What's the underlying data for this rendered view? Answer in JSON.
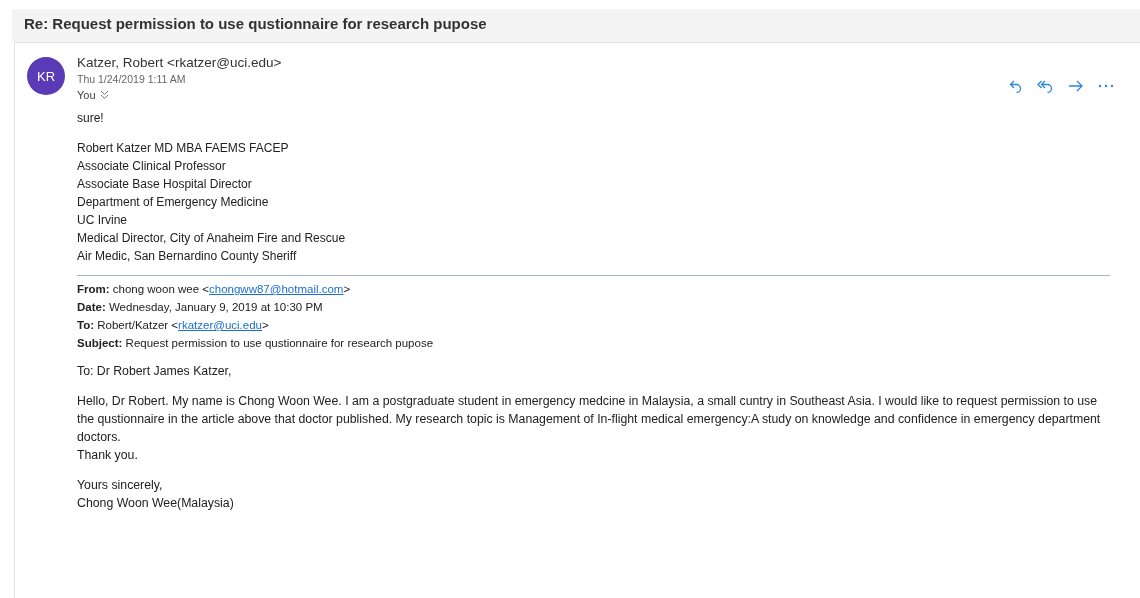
{
  "subject": "Re: Request permission to use qustionnaire for research pupose",
  "message": {
    "avatar_initials": "KR",
    "sender": "Katzer, Robert <rkatzer@uci.edu>",
    "date": "Thu 1/24/2019 1:11 AM",
    "recipient": "You",
    "actions": [
      {
        "kind": "reply"
      },
      {
        "kind": "reply_all"
      },
      {
        "kind": "forward"
      },
      {
        "kind": "more"
      }
    ],
    "body": "sure!",
    "signature": [
      "Robert Katzer MD MBA FAEMS FACEP",
      "Associate Clinical Professor",
      "Associate Base Hospital Director",
      "Department of Emergency Medicine",
      "UC Irvine",
      "Medical Director, City of Anaheim Fire and Rescue",
      "Air Medic, San Bernardino County Sheriff"
    ],
    "quoted_header": [
      {
        "label": "From:",
        "text": "chong woon wee <",
        "link": "chongww87@hotmail.com",
        "after": ">"
      },
      {
        "label": "Date:",
        "text": "Wednesday, January 9, 2019 at 10:30 PM"
      },
      {
        "label": "To:",
        "text": "Robert/Katzer <",
        "link": "rkatzer@uci.edu",
        "after": ">"
      },
      {
        "label": "Subject:",
        "text": "Request permission to use qustionnaire for research pupose"
      }
    ],
    "quoted_body": [
      [
        "To: Dr Robert James Katzer,"
      ],
      [
        "Hello, Dr Robert. My name is Chong Woon Wee. I am a postgraduate student in emergency medcine in Malaysia, a small cuntry in Southeast Asia. I would like to request permission to use the qustionnaire in the article above that doctor published. My research topic is Management of In-flight medical emergency:A study on knowledge and confidence in emergency department doctors.",
        "Thank you."
      ],
      [
        "Yours sincerely,",
        "Chong Woon Wee(Malaysia)"
      ]
    ]
  }
}
